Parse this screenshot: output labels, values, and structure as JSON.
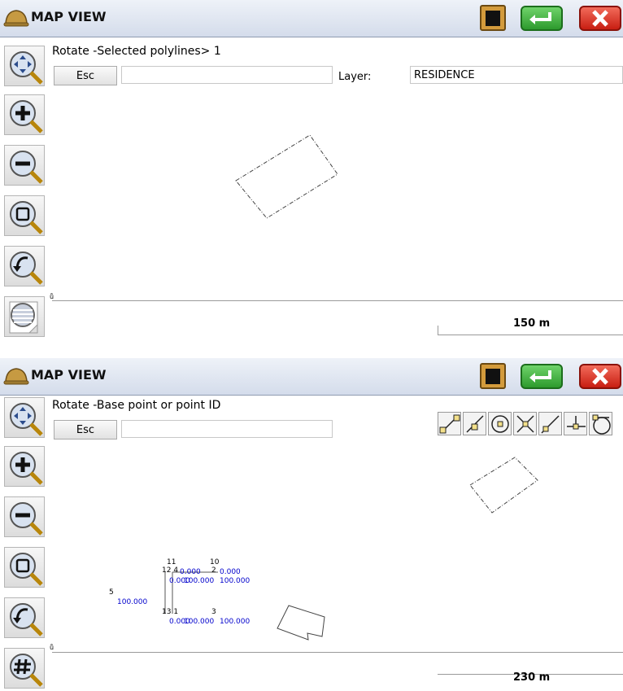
{
  "panel1": {
    "title": "MAP VIEW",
    "command": "Rotate  -Selected polylines> 1",
    "esc_label": "Esc",
    "input_value": "",
    "layer_label": "Layer:",
    "layer_value": "RESIDENCE",
    "scale_label": "150 m"
  },
  "panel2": {
    "title": "MAP VIEW",
    "command": "Rotate  -Base point or point ID",
    "esc_label": "Esc",
    "input_value": "",
    "scale_label": "230 m",
    "points": {
      "p11": "11",
      "p10": "10",
      "p12_4": "12 4",
      "p2": "2",
      "p5": "5",
      "p13_1": "13 1",
      "p3": "3",
      "v_a": "0.000",
      "v_b": "0.000",
      "v_c": "0.000",
      "v_d": "100.000",
      "v_e": "100.000",
      "v_f": "0.000",
      "v_g": "100.000",
      "v_h": "100.000"
    }
  },
  "icons": {
    "titlebar_left": "hardhat-icon",
    "clipboard": "clipboard-icon",
    "ok": "enter-icon",
    "cancel": "close-icon"
  },
  "colors": {
    "titlebar": "#dde3ee",
    "ok": "#3cb43c",
    "cancel": "#e0291a",
    "point_values": "#0000cc"
  }
}
